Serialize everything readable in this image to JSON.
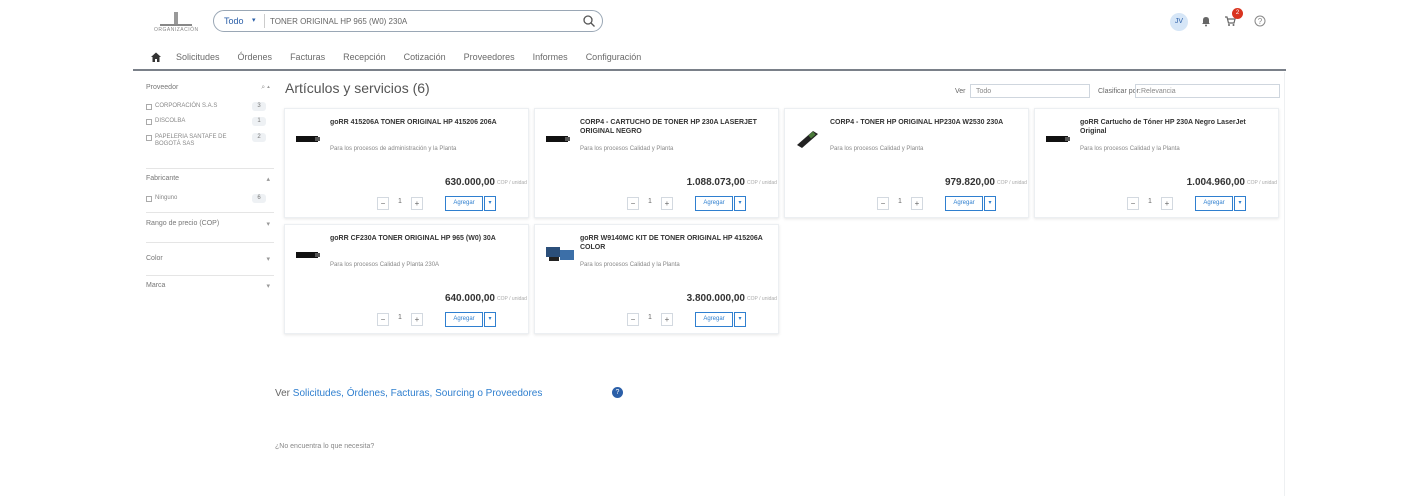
{
  "header": {
    "logo_text": "ORGANIZACIÓN",
    "search": {
      "scope": "Todo",
      "query": "TONER ORIGINAL HP 965 (W0) 230A"
    },
    "notification_count": "2",
    "user_initials": "JV"
  },
  "nav": {
    "items": [
      "Solicitudes",
      "Órdenes",
      "Facturas",
      "Recepción",
      "Cotización",
      "Proveedores",
      "Informes",
      "Configuración"
    ]
  },
  "filters": {
    "proveedor_label": "Proveedor",
    "proveedor_items": [
      {
        "label": "CORPORACIÓN S.A.S",
        "count": "3"
      },
      {
        "label": "DISCOLBA",
        "count": "1"
      },
      {
        "label": "PAPELERIA SANTAFE DE BOGOTÁ SAS",
        "count": "2"
      }
    ],
    "fabricante_label": "Fabricante",
    "fabricante_items": [
      {
        "label": "Ninguno",
        "count": "6"
      }
    ],
    "precio_label": "Rango de precio (COP)",
    "color_label": "Color",
    "marca_label": "Marca"
  },
  "results": {
    "title": "Artículos y servicios (6)",
    "ver_label": "Ver",
    "ver_value": "Todo",
    "clasificar_label": "Clasificar por:",
    "clasificar_value": "Relevancia"
  },
  "products": [
    {
      "name": "goRR 415206A TONER ORIGINAL HP 415206 206A",
      "desc": "Para los procesos de administración y la Planta",
      "price": "630.000,00",
      "currency": "COP / unidad",
      "qty": "1",
      "add": "Agregar"
    },
    {
      "name": "CORP4 - CARTUCHO DE TONER HP 230A LASERJET ORIGINAL NEGRO",
      "desc": "Para los procesos Calidad y Planta",
      "price": "1.088.073,00",
      "currency": "COP / unidad",
      "qty": "1",
      "add": "Agregar"
    },
    {
      "name": "CORP4 - TONER HP ORIGINAL HP230A W2530 230A",
      "desc": "Para los procesos Calidad y Planta",
      "price": "979.820,00",
      "currency": "COP / unidad",
      "qty": "1",
      "add": "Agregar"
    },
    {
      "name": "goRR Cartucho de Tóner HP 230A Negro LaserJet Original",
      "desc": "Para los procesos Calidad y la Planta",
      "price": "1.004.960,00",
      "currency": "COP / unidad",
      "qty": "1",
      "add": "Agregar"
    },
    {
      "name": "goRR CF230A TONER ORIGINAL HP 965 (W0) 30A",
      "desc": "Para los procesos Calidad y Planta 230A",
      "price": "640.000,00",
      "currency": "COP / unidad",
      "qty": "1",
      "add": "Agregar"
    },
    {
      "name": "goRR W9140MC KIT DE TONER ORIGINAL HP 415206A COLOR",
      "desc": "Para los procesos Calidad y la Planta",
      "price": "3.800.000,00",
      "currency": "COP / unidad",
      "qty": "1",
      "add": "Agregar"
    }
  ],
  "footer": {
    "ver_prefix": "Ver",
    "ver_links": "Solicitudes, Órdenes, Facturas, Sourcing o Proveedores",
    "not_found": "¿No encuentra lo que necesita?"
  },
  "colors": {
    "accent": "#2f7fcf",
    "badge": "#d9341f",
    "navline": "#7a8089"
  }
}
